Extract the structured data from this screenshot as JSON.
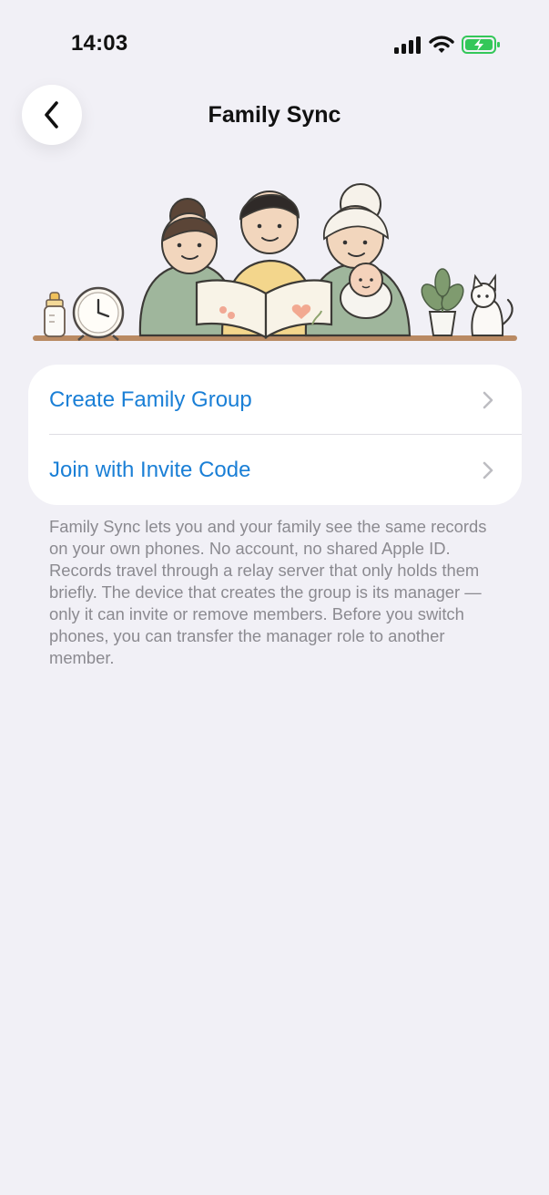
{
  "status_bar": {
    "time": "14:03"
  },
  "nav": {
    "title": "Family Sync",
    "back_icon": "chevron-left-icon"
  },
  "menu": {
    "items": [
      {
        "label": "Create Family Group",
        "icon": "chevron-right-icon"
      },
      {
        "label": "Join with Invite Code",
        "icon": "chevron-right-icon"
      }
    ]
  },
  "footer": {
    "text": "Family Sync lets you and your family see the same records on your own phones. No account, no shared Apple ID. Records travel through a relay server that only holds them briefly. The device that creates the group is its manager — only it can invite or remove members. Before you switch phones, you can transfer the manager role to another member."
  },
  "colors": {
    "background": "#f1f0f6",
    "accent": "#1a7fd6",
    "secondary_text": "#8b8a90",
    "battery": "#34c759"
  }
}
